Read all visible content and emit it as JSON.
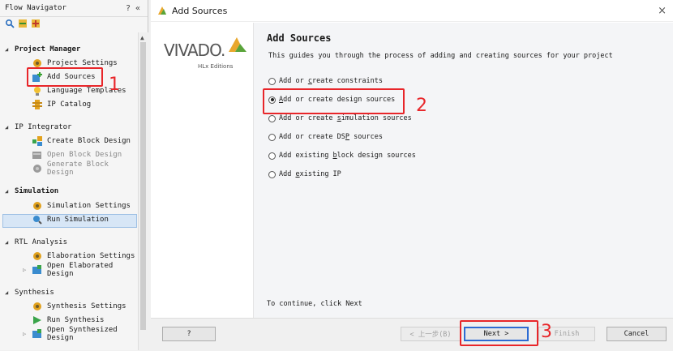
{
  "flow_navigator": {
    "title": "Flow Navigator",
    "help": "?",
    "collapse": "«",
    "sections": [
      {
        "label": "Project Manager",
        "items": [
          "Project Settings",
          "Add Sources",
          "Language Templates",
          "IP Catalog"
        ]
      },
      {
        "label": "IP Integrator",
        "items": [
          "Create Block Design",
          "Open Block Design",
          "Generate Block Design"
        ]
      },
      {
        "label": "Simulation",
        "items": [
          "Simulation Settings",
          "Run Simulation"
        ]
      },
      {
        "label": "RTL Analysis",
        "items": [
          "Elaboration Settings",
          "Open Elaborated Design"
        ]
      },
      {
        "label": "Synthesis",
        "items": [
          "Synthesis Settings",
          "Run Synthesis",
          "Open Synthesized Design"
        ]
      }
    ]
  },
  "annotations": {
    "one": "1",
    "two": "2",
    "three": "3"
  },
  "dialog": {
    "title": "Add Sources",
    "close": "×",
    "logo": {
      "text": "VIVADO.",
      "sub": "HLx Editions"
    },
    "heading": "Add Sources",
    "description": "This guides you through the process of adding and creating sources for your project",
    "options": [
      {
        "pre": "Add or ",
        "u": "c",
        "post": "reate constraints",
        "selected": false
      },
      {
        "pre": "",
        "u": "A",
        "post": "dd or create design sources",
        "selected": true
      },
      {
        "pre": "Add or create ",
        "u": "s",
        "post": "imulation sources",
        "selected": false
      },
      {
        "pre": "Add or create DS",
        "u": "P",
        "post": " sources",
        "selected": false
      },
      {
        "pre": "Add existing ",
        "u": "b",
        "post": "lock design sources",
        "selected": false
      },
      {
        "pre": "Add ",
        "u": "e",
        "post": "xisting IP",
        "selected": false
      }
    ],
    "continue_text": "To continue, click Next",
    "buttons": {
      "help": "?",
      "back": "< 上一步(B)",
      "next": "Next >",
      "finish": "Finish",
      "cancel": "Cancel"
    }
  },
  "colors": {
    "annotation": "#e8262a",
    "selection": "#d7e6f6",
    "default_button": "#2d6bd2"
  }
}
